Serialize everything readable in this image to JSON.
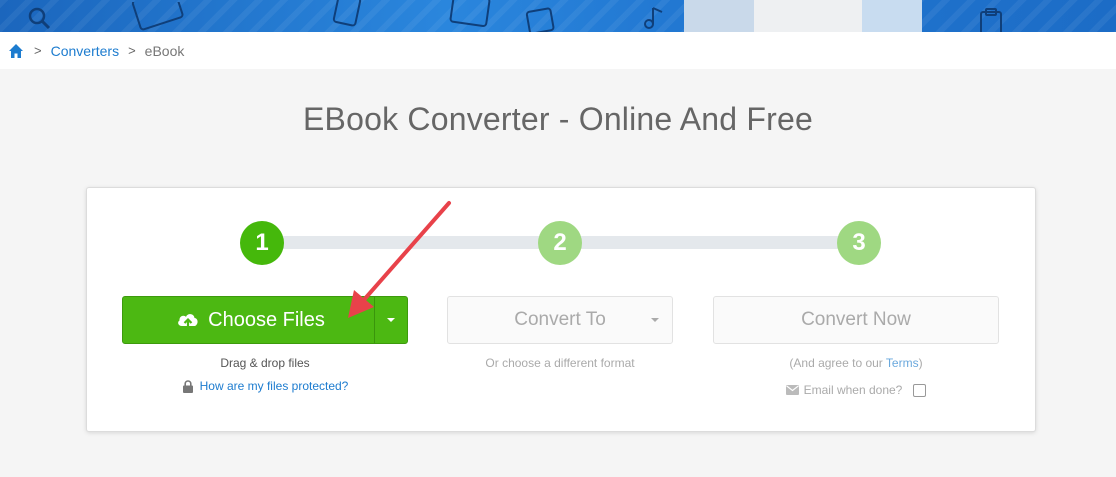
{
  "breadcrumb": {
    "home_icon": "home-icon",
    "items": [
      "Converters",
      "eBook"
    ],
    "separator": ">"
  },
  "title": "EBook Converter - Online And Free",
  "steps": [
    "1",
    "2",
    "3"
  ],
  "choose_files": {
    "label": "Choose Files",
    "icon": "cloud-upload-icon",
    "hint": "Drag & drop files",
    "protected_link": "How are my files protected?"
  },
  "convert_to": {
    "label": "Convert To",
    "hint": "Or choose a different format"
  },
  "convert_now": {
    "label": "Convert Now",
    "hint_prefix": "(And agree to our ",
    "terms_link": "Terms",
    "hint_suffix": ")",
    "email_label": "Email when done?"
  },
  "colors": {
    "primary_green": "#4cb812",
    "step_active": "#45b80b",
    "step_inactive": "#9fd882",
    "link_blue": "#1d7ccf",
    "annotation_red": "#e8424a"
  }
}
